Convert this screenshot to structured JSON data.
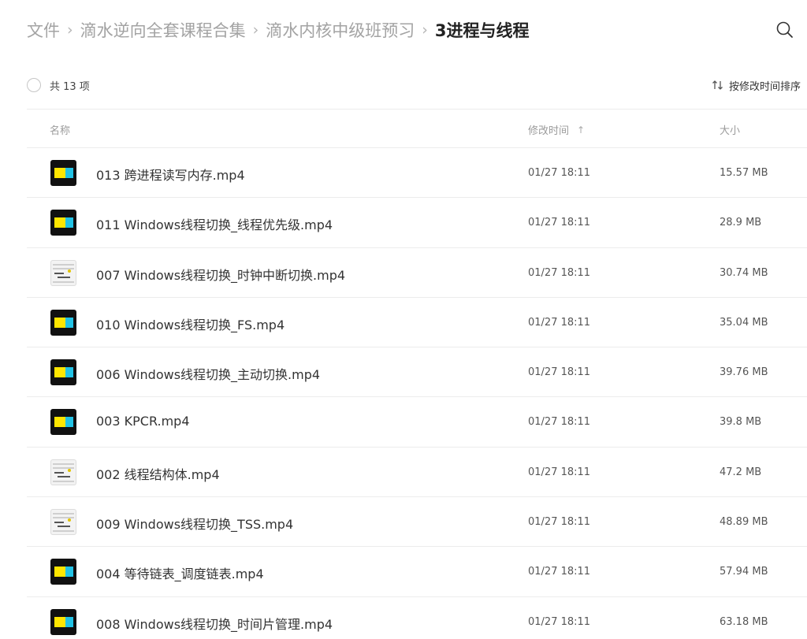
{
  "breadcrumb": [
    {
      "label": "文件"
    },
    {
      "label": "滴水逆向全套课程合集"
    },
    {
      "label": "滴水内核中级班预习"
    },
    {
      "label": "3进程与线程"
    }
  ],
  "separator": "›",
  "icons": {
    "search": "search-icon",
    "sort": "sort-arrows-icon"
  },
  "toolbar": {
    "count_text": "共 13 项",
    "sort_label": "按修改时间排序"
  },
  "table": {
    "headers": {
      "name": "名称",
      "modified": "修改时间",
      "size": "大小",
      "sort_arrow": "↑"
    },
    "rows": [
      {
        "name": "013 跨进程读写内存.mp4",
        "modified": "01/27 18:11",
        "size": "15.57 MB",
        "thumb": "brand"
      },
      {
        "name": "011 Windows线程切换_线程优先级.mp4",
        "modified": "01/27 18:11",
        "size": "28.9 MB",
        "thumb": "brand"
      },
      {
        "name": "007 Windows线程切换_时钟中断切换.mp4",
        "modified": "01/27 18:11",
        "size": "30.74 MB",
        "thumb": "shot"
      },
      {
        "name": "010 Windows线程切换_FS.mp4",
        "modified": "01/27 18:11",
        "size": "35.04 MB",
        "thumb": "brand"
      },
      {
        "name": "006 Windows线程切换_主动切换.mp4",
        "modified": "01/27 18:11",
        "size": "39.76 MB",
        "thumb": "brand"
      },
      {
        "name": "003 KPCR.mp4",
        "modified": "01/27 18:11",
        "size": "39.8 MB",
        "thumb": "brand"
      },
      {
        "name": "002 线程结构体.mp4",
        "modified": "01/27 18:11",
        "size": "47.2 MB",
        "thumb": "shot"
      },
      {
        "name": "009 Windows线程切换_TSS.mp4",
        "modified": "01/27 18:11",
        "size": "48.89 MB",
        "thumb": "shot"
      },
      {
        "name": "004 等待链表_调度链表.mp4",
        "modified": "01/27 18:11",
        "size": "57.94 MB",
        "thumb": "brand"
      },
      {
        "name": "008 Windows线程切换_时间片管理.mp4",
        "modified": "01/27 18:11",
        "size": "63.18 MB",
        "thumb": "brand"
      }
    ]
  },
  "colors": {
    "thumb_yellow": "#ffe600",
    "thumb_cyan": "#22c3e6",
    "thumb_black": "#111111"
  }
}
